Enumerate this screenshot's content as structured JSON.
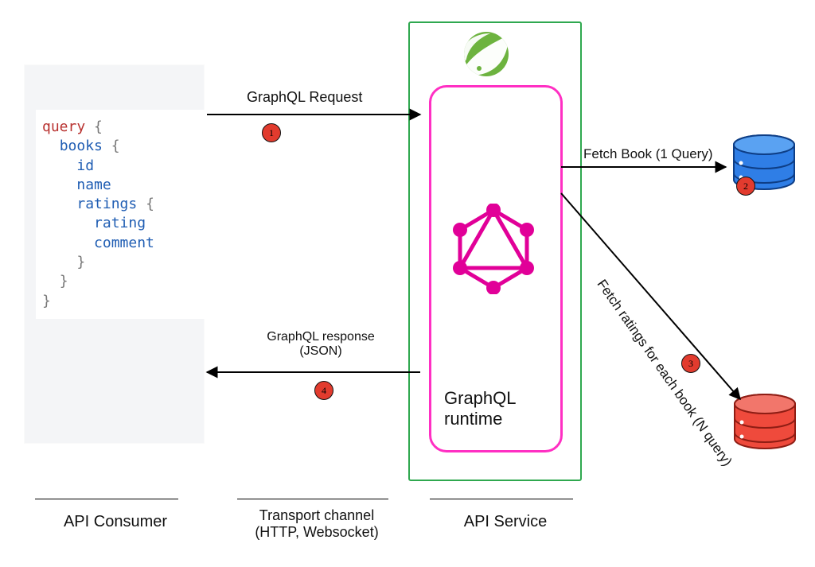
{
  "code": {
    "tokens": [
      {
        "t": "query",
        "c": "kw"
      },
      {
        "t": " ",
        "c": ""
      },
      {
        "t": "{",
        "c": "brace"
      },
      {
        "t": "\n",
        "c": ""
      },
      {
        "t": "  ",
        "c": ""
      },
      {
        "t": "books",
        "c": "fld"
      },
      {
        "t": " ",
        "c": ""
      },
      {
        "t": "{",
        "c": "brace"
      },
      {
        "t": "\n",
        "c": ""
      },
      {
        "t": "    ",
        "c": ""
      },
      {
        "t": "id",
        "c": "fld"
      },
      {
        "t": "\n",
        "c": ""
      },
      {
        "t": "    ",
        "c": ""
      },
      {
        "t": "name",
        "c": "fld"
      },
      {
        "t": "\n",
        "c": ""
      },
      {
        "t": "    ",
        "c": ""
      },
      {
        "t": "ratings",
        "c": "fld"
      },
      {
        "t": " ",
        "c": ""
      },
      {
        "t": "{",
        "c": "brace"
      },
      {
        "t": "\n",
        "c": ""
      },
      {
        "t": "      ",
        "c": ""
      },
      {
        "t": "rating",
        "c": "fld"
      },
      {
        "t": "\n",
        "c": ""
      },
      {
        "t": "      ",
        "c": ""
      },
      {
        "t": "comment",
        "c": "fld"
      },
      {
        "t": "\n",
        "c": ""
      },
      {
        "t": "    ",
        "c": ""
      },
      {
        "t": "}",
        "c": "brace"
      },
      {
        "t": "\n",
        "c": ""
      },
      {
        "t": "  ",
        "c": ""
      },
      {
        "t": "}",
        "c": "brace"
      },
      {
        "t": "\n",
        "c": ""
      },
      {
        "t": "}",
        "c": "brace"
      }
    ]
  },
  "labels": {
    "request": "GraphQL Request",
    "response_l1": "GraphQL response",
    "response_l2": "(JSON)",
    "fetch_book": "Fetch Book (1 Query)",
    "fetch_ratings": "Fetch ratings for each book (N query)",
    "runtime": "GraphQL\nruntime"
  },
  "steps": {
    "s1": "1",
    "s2": "2",
    "s3": "3",
    "s4": "4"
  },
  "footer": {
    "consumer": "API Consumer",
    "transport_l1": "Transport channel",
    "transport_l2": "(HTTP, Websocket)",
    "service": "API Service"
  },
  "icons": {
    "spring": "spring-leaf",
    "graphql": "graphql-logo",
    "db_blue": "database",
    "db_red": "database"
  },
  "colors": {
    "spring": "#6db33f",
    "pink": "#ff2fc3",
    "badge": "#e23b2e",
    "blue1": "#2f7ee6",
    "blue2": "#1b5fc4",
    "red1": "#ef4a3c",
    "red2": "#d6382b"
  }
}
